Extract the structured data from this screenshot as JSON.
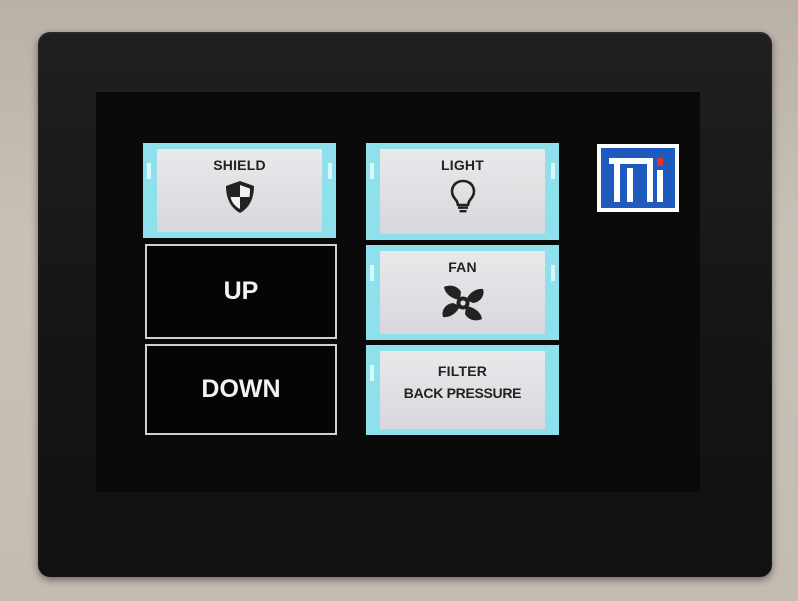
{
  "panel": {
    "buttons_left": [
      {
        "label": "SHIELD",
        "icon": "shield-icon",
        "style": "lit"
      },
      {
        "label": "UP",
        "style": "dark"
      },
      {
        "label": "DOWN",
        "style": "dark"
      }
    ],
    "buttons_right": [
      {
        "label": "LIGHT",
        "icon": "lightbulb-icon",
        "style": "lit"
      },
      {
        "label": "FAN",
        "icon": "fan-icon",
        "style": "lit"
      },
      {
        "label": "FILTER",
        "label2": "BACK PRESSURE",
        "style": "lit"
      }
    ],
    "logo": {
      "text": "TJ"
    }
  },
  "colors": {
    "button_highlight": "#8ee0ec",
    "button_face": "#e0e0e3",
    "logo_blue": "#1f5bbf",
    "logo_red": "#e0312c"
  }
}
